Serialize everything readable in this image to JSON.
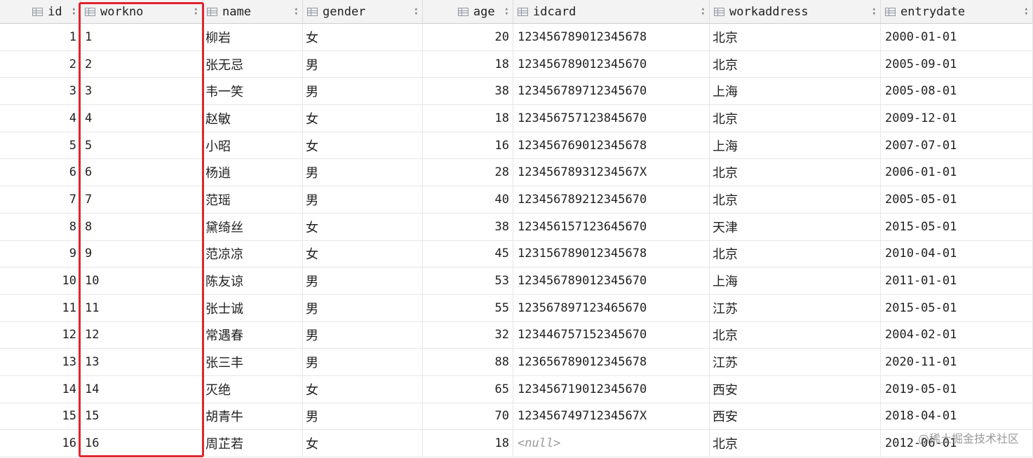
{
  "colors": {
    "highlight": "#e0242e",
    "header_bg": "#f3f3f3",
    "null_text": "#9a9a9a"
  },
  "columns": [
    {
      "key": "id",
      "label": "id",
      "align": "right",
      "icon": "table-column-icon",
      "sort_icon": "sort-arrows-icon"
    },
    {
      "key": "workno",
      "label": "workno",
      "align": "left",
      "icon": "table-column-icon",
      "sort_icon": "sort-arrows-icon"
    },
    {
      "key": "name",
      "label": "name",
      "align": "left",
      "icon": "table-column-icon",
      "sort_icon": "sort-arrows-icon"
    },
    {
      "key": "gender",
      "label": "gender",
      "align": "left",
      "icon": "table-column-icon",
      "sort_icon": "sort-arrows-icon"
    },
    {
      "key": "age",
      "label": "age",
      "align": "right",
      "icon": "table-column-icon",
      "sort_icon": "sort-arrows-icon"
    },
    {
      "key": "idcard",
      "label": "idcard",
      "align": "left",
      "icon": "table-column-icon",
      "sort_icon": "sort-arrows-icon"
    },
    {
      "key": "workaddress",
      "label": "workaddress",
      "align": "left",
      "icon": "table-column-icon",
      "sort_icon": "sort-arrows-icon"
    },
    {
      "key": "entrydate",
      "label": "entrydate",
      "align": "left",
      "icon": "table-column-icon",
      "sort_icon": "sort-arrows-icon"
    }
  ],
  "rows": [
    [
      "1",
      "1",
      "柳岩",
      "女",
      "20",
      "123456789012345678",
      "北京",
      "2000-01-01"
    ],
    [
      "2",
      "2",
      "张无忌",
      "男",
      "18",
      "123456789012345670",
      "北京",
      "2005-09-01"
    ],
    [
      "3",
      "3",
      "韦一笑",
      "男",
      "38",
      "123456789712345670",
      "上海",
      "2005-08-01"
    ],
    [
      "4",
      "4",
      "赵敏",
      "女",
      "18",
      "123456757123845670",
      "北京",
      "2009-12-01"
    ],
    [
      "5",
      "5",
      "小昭",
      "女",
      "16",
      "123456769012345678",
      "上海",
      "2007-07-01"
    ],
    [
      "6",
      "6",
      "杨逍",
      "男",
      "28",
      "12345678931234567X",
      "北京",
      "2006-01-01"
    ],
    [
      "7",
      "7",
      "范瑶",
      "男",
      "40",
      "123456789212345670",
      "北京",
      "2005-05-01"
    ],
    [
      "8",
      "8",
      "黛绮丝",
      "女",
      "38",
      "123456157123645670",
      "天津",
      "2015-05-01"
    ],
    [
      "9",
      "9",
      "范凉凉",
      "女",
      "45",
      "123156789012345678",
      "北京",
      "2010-04-01"
    ],
    [
      "10",
      "10",
      "陈友谅",
      "男",
      "53",
      "123456789012345670",
      "上海",
      "2011-01-01"
    ],
    [
      "11",
      "11",
      "张士诚",
      "男",
      "55",
      "123567897123465670",
      "江苏",
      "2015-05-01"
    ],
    [
      "12",
      "12",
      "常遇春",
      "男",
      "32",
      "123446757152345670",
      "北京",
      "2004-02-01"
    ],
    [
      "13",
      "13",
      "张三丰",
      "男",
      "88",
      "123656789012345678",
      "江苏",
      "2020-11-01"
    ],
    [
      "14",
      "14",
      "灭绝",
      "女",
      "65",
      "123456719012345670",
      "西安",
      "2019-05-01"
    ],
    [
      "15",
      "15",
      "胡青牛",
      "男",
      "70",
      "12345674971234567X",
      "西安",
      "2018-04-01"
    ],
    [
      "16",
      "16",
      "周芷若",
      "女",
      "18",
      "<null>",
      "北京",
      "2012-06-01"
    ]
  ],
  "highlighted_column": "workno",
  "watermark": "@稀土掘金技术社区"
}
